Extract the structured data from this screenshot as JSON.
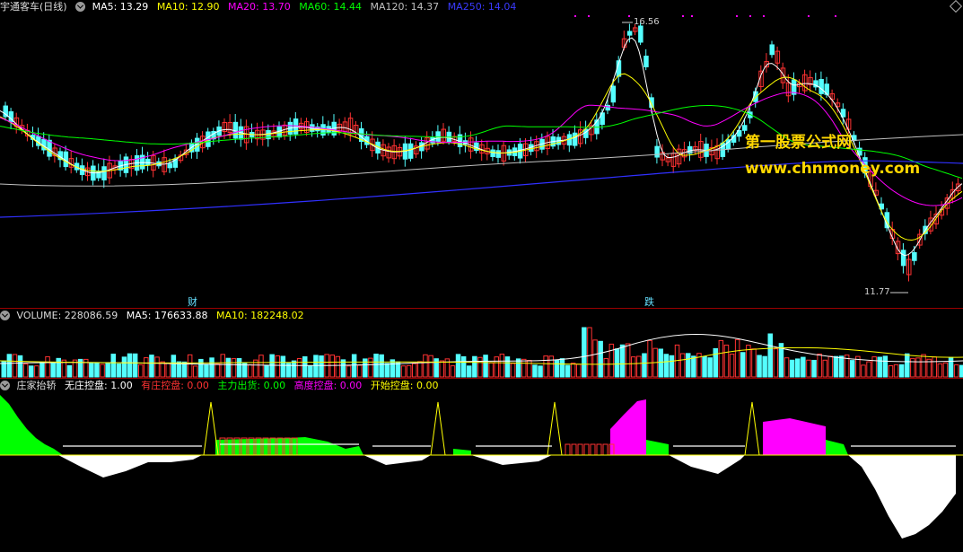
{
  "main": {
    "title": "宇通客车(日线)",
    "ma5": "MA5: 13.29",
    "ma10": "MA10: 12.90",
    "ma20": "MA20: 13.70",
    "ma60": "MA60: 14.44",
    "ma120": "MA120: 14.37",
    "ma250": "MA250: 14.04",
    "high_label": "16.56",
    "low_label": "11.77",
    "mark_cai": "财",
    "mark_die": "跌",
    "watermark1": "第一股票公式网",
    "watermark2": "www.chnmoney.com"
  },
  "volume": {
    "title": "VOLUME: 228086.59",
    "ma5": "MA5: 176633.88",
    "ma10": "MA10: 182248.02"
  },
  "indicator": {
    "title": "庄家抬轿",
    "wu": "无庄控盘: 1.00",
    "you": "有庄控盘: 0.00",
    "zhu": "主力出货: 0.00",
    "gao": "高度控盘: 0.00",
    "kai": "开始控盘: 0.00"
  },
  "colors": {
    "up": "#ff3232",
    "down": "#54ffff",
    "ma5": "#ffffff",
    "ma10": "#ffff00",
    "ma20": "#ff00ff",
    "ma60": "#00ff00",
    "ma120": "#c0c0c0",
    "ma250": "#3030ff",
    "green": "#00ff00",
    "magenta": "#ff00ff"
  }
}
